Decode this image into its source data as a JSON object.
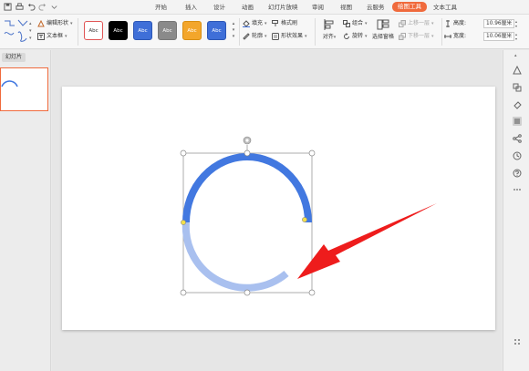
{
  "tabs": {
    "items": [
      "开始",
      "插入",
      "设计",
      "动画",
      "幻灯片放映",
      "审阅",
      "视图",
      "云服务",
      "绘图工具",
      "文本工具"
    ],
    "active": "绘图工具"
  },
  "ribbon": {
    "edit_shape": "编辑形状",
    "text_box": "文本框",
    "style_label": "Abc",
    "fill": "填充",
    "format_painter": "格式刷",
    "outline": "轮廓",
    "shape_effect": "形状效果",
    "align": "对齐",
    "group": "组合",
    "rotate": "旋转",
    "selection_pane": "选择窗格",
    "bring_forward": "上移一层",
    "send_backward": "下移一层",
    "height_label": "高度:",
    "height_value": "10.96厘米",
    "width_label": "宽度:",
    "width_value": "10.06厘米"
  },
  "style_swatches": [
    {
      "bg": "#ffffff",
      "fg": "#333333",
      "border": "#e05555"
    },
    {
      "bg": "#000000",
      "fg": "#ffffff",
      "border": "#000000"
    },
    {
      "bg": "#3f6fd8",
      "fg": "#ffffff",
      "border": "#2c56b5"
    },
    {
      "bg": "#8a8a8a",
      "fg": "#ffffff",
      "border": "#777777"
    },
    {
      "bg": "#f3a62b",
      "fg": "#ffffff",
      "border": "#d98e12"
    },
    {
      "bg": "#3f6fd8",
      "fg": "#ffffff",
      "border": "#2c56b5"
    }
  ],
  "left_panel": {
    "slides_tab": "幻灯片"
  },
  "colors": {
    "accent": "#f06a3c",
    "arc_top": "#4278e0",
    "arc_bottom": "#a9c0ef",
    "arrow": "#ee1c1c"
  },
  "icons": [
    "save-icon",
    "print-icon",
    "undo-icon",
    "redo-icon",
    "more-icon",
    "shape-line-icon",
    "shape-curve-icon",
    "edit-shape-icon",
    "text-box-icon",
    "fill-icon",
    "format-painter-icon",
    "outline-icon",
    "shape-effect-icon",
    "align-icon",
    "group-icon",
    "rotate-icon",
    "selection-pane-icon",
    "bring-forward-icon",
    "send-backward-icon",
    "height-icon",
    "width-icon",
    "rotation-handle-icon",
    "arrow-up-icon",
    "shape-icon",
    "shapes-icon",
    "clear-icon",
    "properties-icon",
    "share-icon",
    "history-icon",
    "help-icon",
    "more-dots-icon",
    "grid-icon"
  ]
}
